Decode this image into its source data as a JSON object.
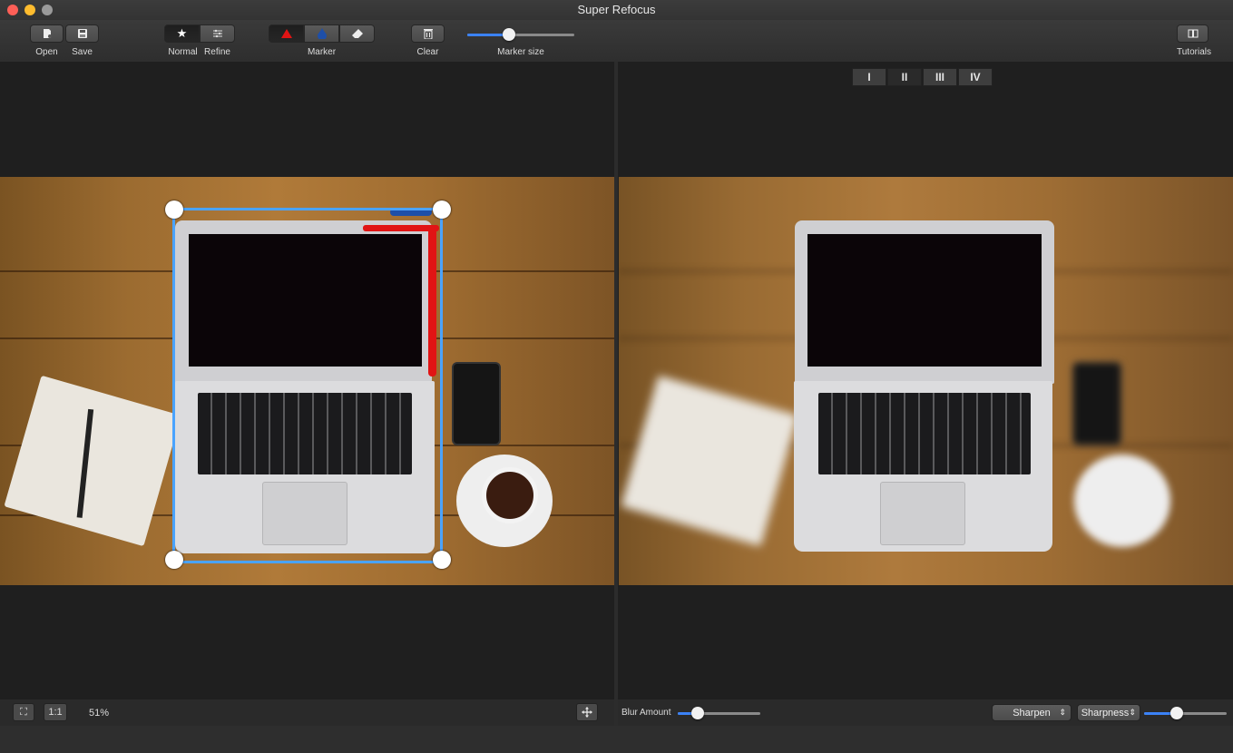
{
  "window": {
    "title": "Super Refocus"
  },
  "toolbar": {
    "open_label": "Open",
    "save_label": "Save",
    "normal_label": "Normal",
    "refine_label": "Refine",
    "marker_label": "Marker",
    "clear_label": "Clear",
    "marker_size_label": "Marker size",
    "marker_size_value": 0.39,
    "tutorials_label": "Tutorials"
  },
  "view_modes": [
    "I",
    "II",
    "III",
    "IV"
  ],
  "selected_view_mode": "II",
  "left_status": {
    "fit_label": "⛶",
    "actual_label": "1:1",
    "zoom": "51%"
  },
  "right_status": {
    "blur_label": "Blur Amount",
    "blur_value": 0.24,
    "sharpen_option": "Sharpen",
    "sharpness_option": "Sharpness",
    "sharpness_value": 0.4
  },
  "colors": {
    "accent": "#3b82f6",
    "marker_red": "#e11414",
    "marker_blue": "#1e4fa8",
    "selection": "#4aa3ff"
  },
  "icons": {
    "open": "open-icon",
    "save": "save-icon",
    "normal": "star-icon",
    "refine": "sliders-icon",
    "marker_red": "triangle-icon",
    "marker_blue": "drop-icon",
    "eraser": "eraser-icon",
    "clear": "trash-icon",
    "tutorials": "book-icon",
    "move": "move-icon"
  }
}
